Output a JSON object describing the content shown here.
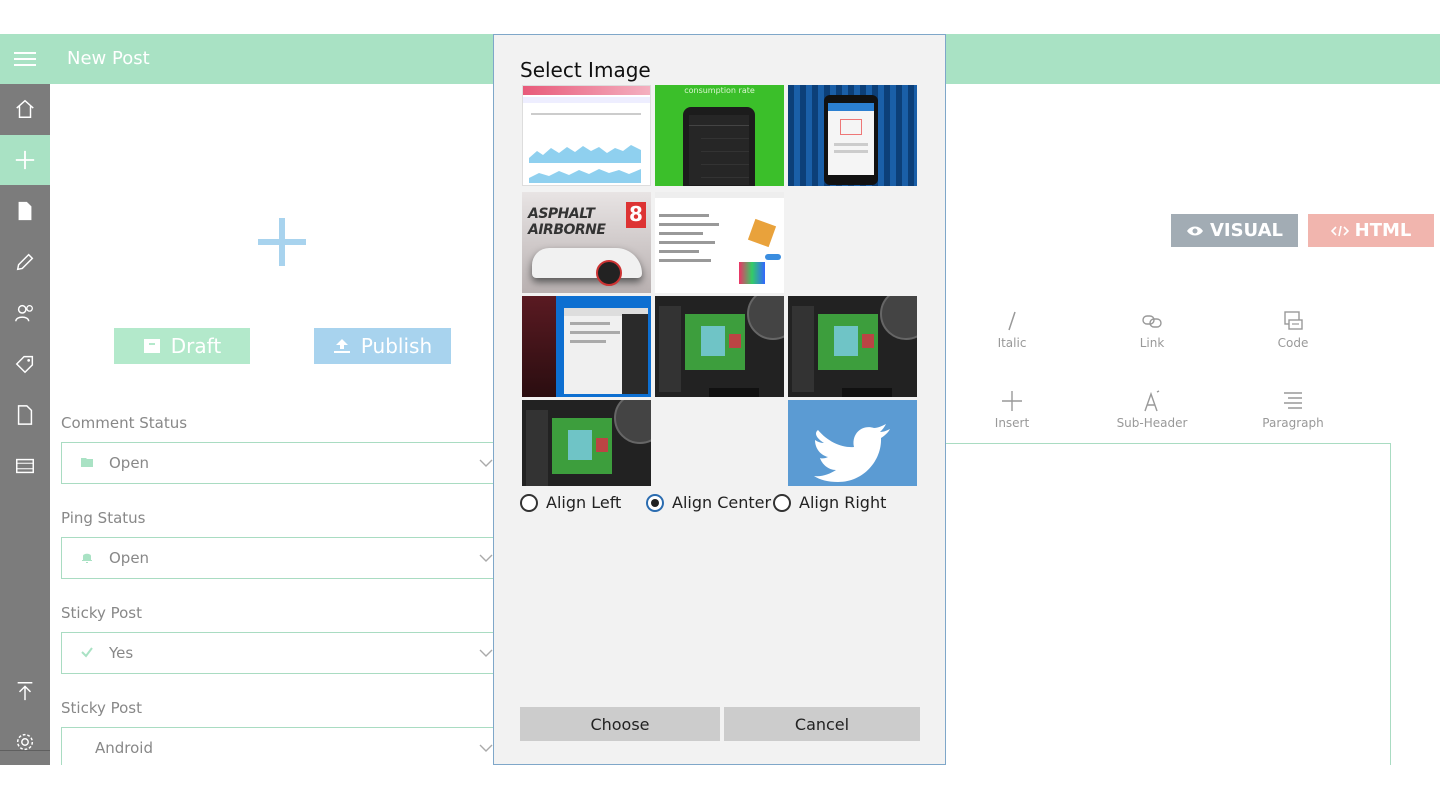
{
  "app": {
    "title": "New Post"
  },
  "actions": {
    "draft_label": "Draft",
    "publish_label": "Publish"
  },
  "fields": [
    {
      "label": "Comment Status",
      "value": "Open",
      "icon": "folder-icon"
    },
    {
      "label": "Ping Status",
      "value": "Open",
      "icon": "bell-icon"
    },
    {
      "label": "Sticky Post",
      "value": "Yes",
      "icon": "check-icon"
    },
    {
      "label": "Sticky Post",
      "value": "Android",
      "icon": ""
    }
  ],
  "editor": {
    "visual_label": "VISUAL",
    "html_label": "HTML",
    "tools": [
      {
        "label": "Italic",
        "icon": "italic-icon"
      },
      {
        "label": "Link",
        "icon": "link-icon"
      },
      {
        "label": "Code",
        "icon": "code-icon"
      },
      {
        "label": "Insert",
        "icon": "plus-icon"
      },
      {
        "label": "Sub-Header",
        "icon": "subheader-icon"
      },
      {
        "label": "Paragraph",
        "icon": "paragraph-icon"
      }
    ]
  },
  "dialog": {
    "title": "Select Image",
    "thumbnails": [
      {
        "name": "analytics-dashboard"
      },
      {
        "name": "phone-green",
        "caption": "consumption rate"
      },
      {
        "name": "phone-blue-curtain"
      },
      {
        "name": "asphalt-game",
        "caption": "ASPHALT AIRBORNE"
      },
      {
        "name": "chat-app"
      },
      {
        "name": "windows-app-blue"
      },
      {
        "name": "minecraft-app-1"
      },
      {
        "name": "minecraft-app-2"
      },
      {
        "name": "minecraft-app-3"
      },
      {
        "name": "twitter-logo"
      }
    ],
    "align_options": [
      {
        "label": "Align Left",
        "selected": false
      },
      {
        "label": "Align Center",
        "selected": true
      },
      {
        "label": "Align Right",
        "selected": false
      }
    ],
    "choose_label": "Choose",
    "cancel_label": "Cancel"
  },
  "colors": {
    "accent_green": "#a9e2c4",
    "sidebar_gray": "#7c7c7c",
    "publish_blue": "#a8d3ee",
    "html_red": "#f1b5ae",
    "visual_gray": "#a2acb4",
    "dialog_bg": "#f2f2f2"
  }
}
